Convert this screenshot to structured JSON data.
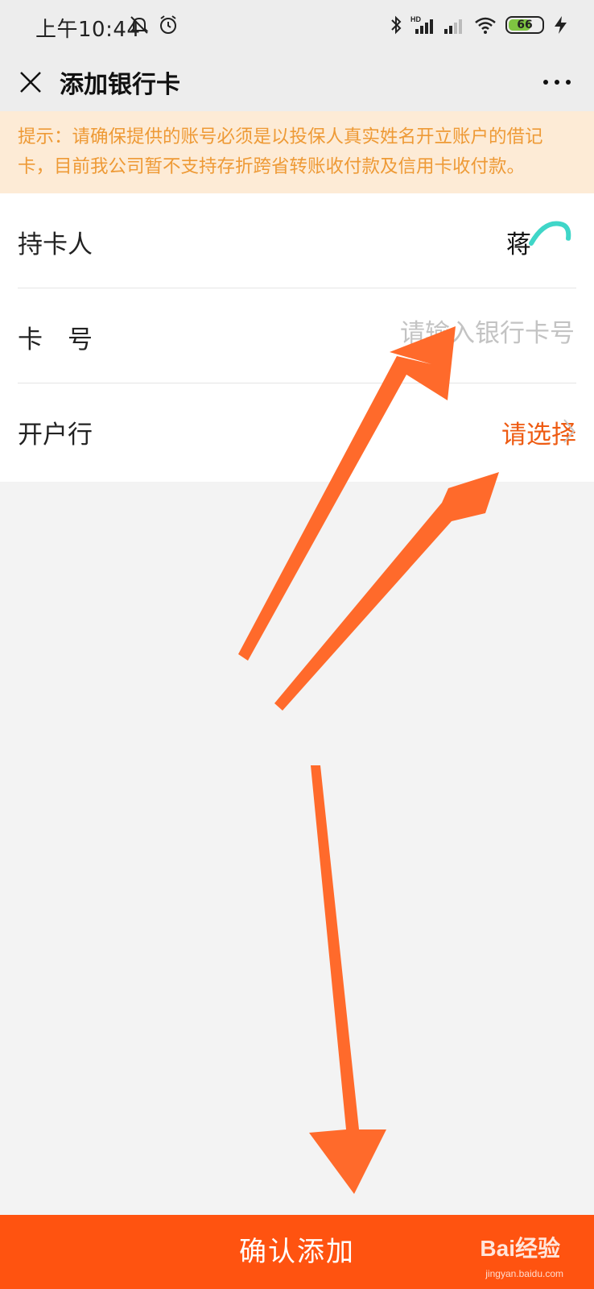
{
  "status_bar": {
    "time": "上午10:44",
    "battery_level": "66",
    "icons": [
      "mute-icon",
      "alarm-icon",
      "bluetooth-icon",
      "hd-signal-icon",
      "signal-icon",
      "wifi-icon",
      "battery-icon",
      "charging-icon"
    ]
  },
  "nav": {
    "title": "添加银行卡",
    "close_icon": "close-icon",
    "more_icon": "more-icon"
  },
  "notice": {
    "text": "提示：请确保提供的账号必须是以投保人真实姓名开立账户的借记卡，目前我公司暂不支持存折跨省转账收付款及信用卡收付款。"
  },
  "form": {
    "holder": {
      "label": "持卡人",
      "value": "蒋"
    },
    "card_number": {
      "label": "卡　号",
      "placeholder": "请输入银行卡号"
    },
    "bank": {
      "label": "开户行",
      "value": "请选择"
    }
  },
  "footer": {
    "confirm_label": "确认添加",
    "watermark": "Bai经验",
    "watermark_sub": "jingyan.baidu.com"
  },
  "colors": {
    "accent": "#ff5310",
    "notice_bg": "#fdebd6",
    "notice_text": "#ee9a36",
    "select_text": "#ee5b12",
    "arrow": "#ff6a2b"
  }
}
